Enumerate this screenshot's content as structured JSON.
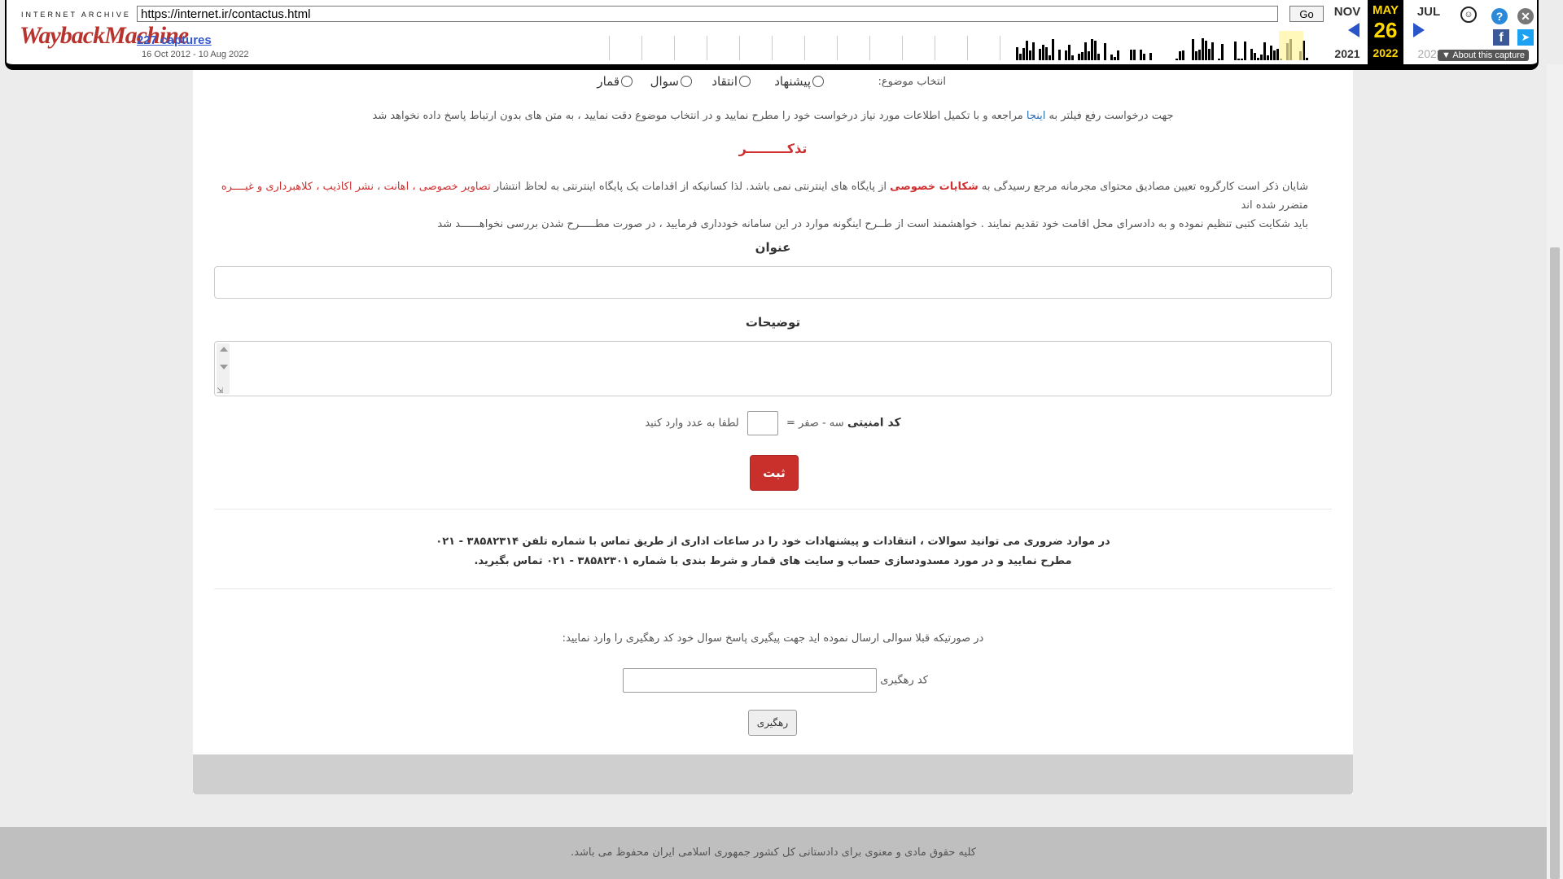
{
  "wayback": {
    "ia_label": "INTERNET ARCHIVE",
    "logo_text": "WaybackMachine",
    "url": "https://internet.ir/contactus.html",
    "go_label": "Go",
    "captures_label": "227 captures",
    "capture_range": "16 Oct 2012 - 10 Aug 2022",
    "prev_month": "NOV",
    "cur_month": "MAY",
    "next_month": "JUL",
    "cur_day": "26",
    "prev_year": "2021",
    "cur_year": "2022",
    "next_year": "2023",
    "about_label": "About this capture",
    "accent": "#ffd700"
  },
  "form": {
    "topic_label": "انتخاب موضوع:",
    "topics": [
      "پیشنهاد",
      "انتقاد",
      "سوال",
      "قمار"
    ],
    "notice_pre": "جهت درخواست رفع فیلتر به",
    "notice_link": "اینجا",
    "notice_post": "مراجعه و با تکمیل اطلاعات مورد نیاز درخواست خود را مطرح نمایید و در انتخاب موضوع دقت نمایید ، به متن های بدون ارتباط پاسخ داده نخواهد شد",
    "reminder": "تذکـــــــــر",
    "warn_1a": "شایان ذکر است کارگروه تعیین مصادیق محتوای مجرمانه مرجع رسیدگی به",
    "warn_1b": "شکایات خصوصی",
    "warn_1c": "از پایگاه های اینترنتی نمی باشد. لذا کسانیکه از اقدامات یک پایگاه اینترنتی به لحاظ انتشار",
    "warn_1d": "تصاویر خصوصی ، اهانت ، نشر اکاذیب ، کلاهبرداری و غیــــره",
    "warn_1e": "متضرر شده اند",
    "warn_2": "باید شکایت کتبی تنظیم نموده و به دادسرای محل اقامت خود تقدیم نمایند . خواهشمند است از طــرح اینگونه موارد در این سامانه خودداری فرمایید ، در صورت مطـــــرح شدن بررسی نخواهــــــد شد",
    "title_label": "عنوان",
    "desc_label": "توضیحات",
    "captcha_label": "کد امنیتی",
    "captcha_question": "سه - صفر =",
    "captcha_hint": "لطفا به عدد وارد کنید",
    "submit_label": "ثبت",
    "contact_1": "در موارد ضروری می توانید سوالات ، انتقادات و پیشنهادات خود را در ساعات اداری از طریق تماس با شماره تلفن ۳۸۵۸۲۳۱۴ - ۰۲۱",
    "contact_2": "مطرح نمایید و در مورد مسدودسازی حساب و سایت های قمار و شرط بندی با شماره ۳۸۵۸۲۳۰۱ - ۰۲۱ تماس بگیرید.",
    "track_note": "در صورتیکه قبلا سوالی ارسال نموده اید جهت پیگیری پاسخ سوال خود کد رهگیری را وارد نمایید:",
    "track_label": "کد رهگیری",
    "track_button": "رهگیری"
  },
  "footer": {
    "text": "کلیه حقوق مادی و معنوی برای دادستانی کل کشور جمهوری اسلامی ایران محفوظ می باشد."
  }
}
